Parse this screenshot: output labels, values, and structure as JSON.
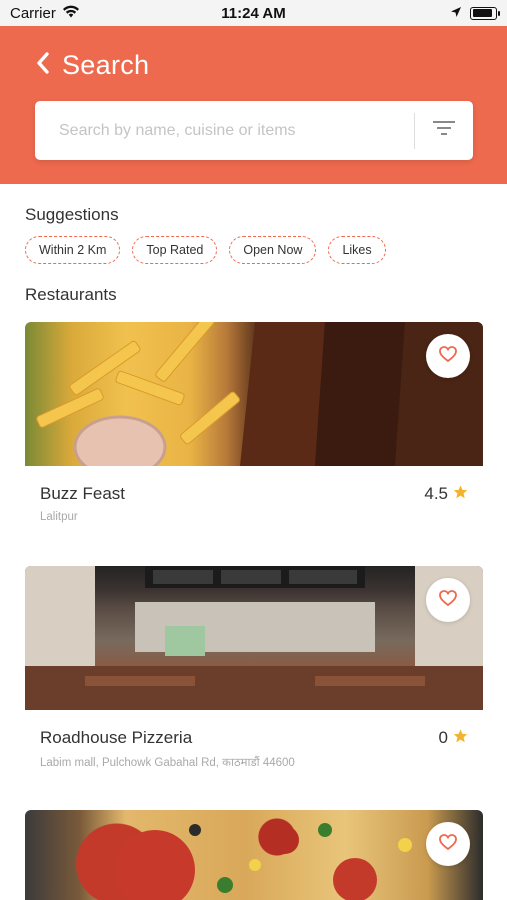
{
  "status_bar": {
    "carrier": "Carrier",
    "time": "11:24 AM",
    "battery_level": 0.9
  },
  "header": {
    "back_label": "Search",
    "search_placeholder": "Search by name, cuisine or items",
    "accent": "#ee6a4e"
  },
  "suggestions": {
    "title": "Suggestions",
    "chips": [
      "Within 2 Km",
      "Top Rated",
      "Open Now",
      "Likes"
    ]
  },
  "restaurants": {
    "title": "Restaurants",
    "items": [
      {
        "name": "Buzz Feast",
        "location": "Lalitpur",
        "rating": "4.5"
      },
      {
        "name": "Roadhouse Pizzeria",
        "location": "Labim mall, Pulchowk Gabahal Rd, काठमाडौं 44600",
        "rating": "0"
      },
      {
        "name": "",
        "location": "",
        "rating": ""
      }
    ]
  }
}
